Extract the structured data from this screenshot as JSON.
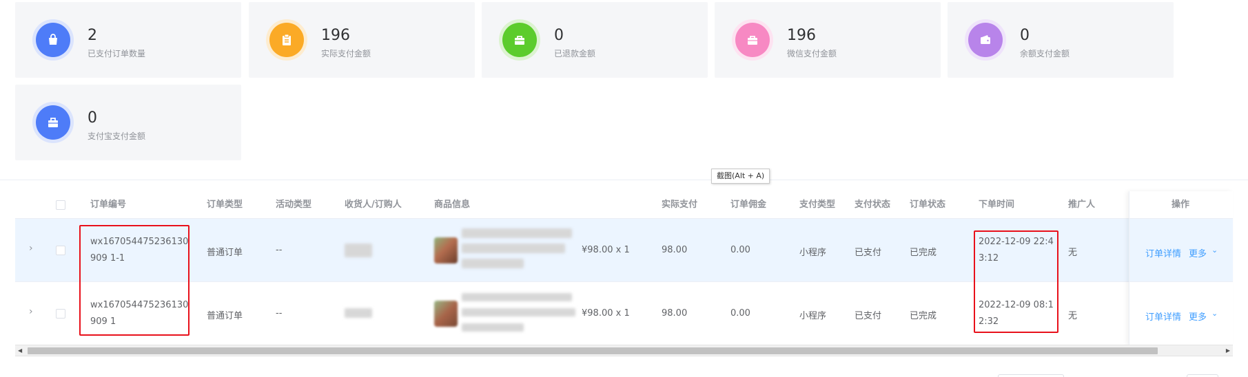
{
  "stats": [
    {
      "value": "2",
      "label": "已支付订单数量",
      "color": "#4e7cf8",
      "icon": "shopping-bag-icon"
    },
    {
      "value": "196",
      "label": "实际支付金额",
      "color": "#fbaa26",
      "icon": "clipboard-icon"
    },
    {
      "value": "0",
      "label": "已退款金额",
      "color": "#5ccc2c",
      "icon": "briefcase-icon"
    },
    {
      "value": "196",
      "label": "微信支付金额",
      "color": "#f789c3",
      "icon": "briefcase-icon"
    },
    {
      "value": "0",
      "label": "余额支付金额",
      "color": "#b884ea",
      "icon": "wallet-icon"
    },
    {
      "value": "0",
      "label": "支付宝支付金额",
      "color": "#4e7cf8",
      "icon": "toolbox-icon"
    }
  ],
  "tooltip": "截图(Alt + A)",
  "table": {
    "headers": {
      "order_no": "订单编号",
      "order_type": "订单类型",
      "activity_type": "活动类型",
      "receiver": "收货人/订购人",
      "product_info": "商品信息",
      "actual_paid": "实际支付",
      "commission": "订单佣金",
      "pay_type": "支付类型",
      "pay_status": "支付状态",
      "order_status": "订单状态",
      "order_time": "下单时间",
      "promoter": "推广人",
      "actions": "操作"
    },
    "rows": [
      {
        "order_no": "wx167054475236130909 1-1",
        "order_type": "普通订单",
        "activity_type": "--",
        "price_qty": "¥98.00 x 1",
        "actual_paid": "98.00",
        "commission": "0.00",
        "pay_type": "小程序",
        "pay_status": "已支付",
        "order_status": "已完成",
        "order_time": "2022-12-09 22:43:12",
        "promoter": "无",
        "detail_link": "订单详情",
        "more_link": "更多"
      },
      {
        "order_no": "wx167054475236130909 1",
        "order_type": "普通订单",
        "activity_type": "--",
        "price_qty": "¥98.00 x 1",
        "actual_paid": "98.00",
        "commission": "0.00",
        "pay_type": "小程序",
        "pay_status": "已支付",
        "order_status": "已完成",
        "order_time": "2022-12-09 08:12:32",
        "promoter": "无",
        "detail_link": "订单详情",
        "more_link": "更多"
      }
    ]
  },
  "colors": {
    "link": "#409eff",
    "highlight_row": "#ecf5ff",
    "annotation": "#e8101a"
  }
}
